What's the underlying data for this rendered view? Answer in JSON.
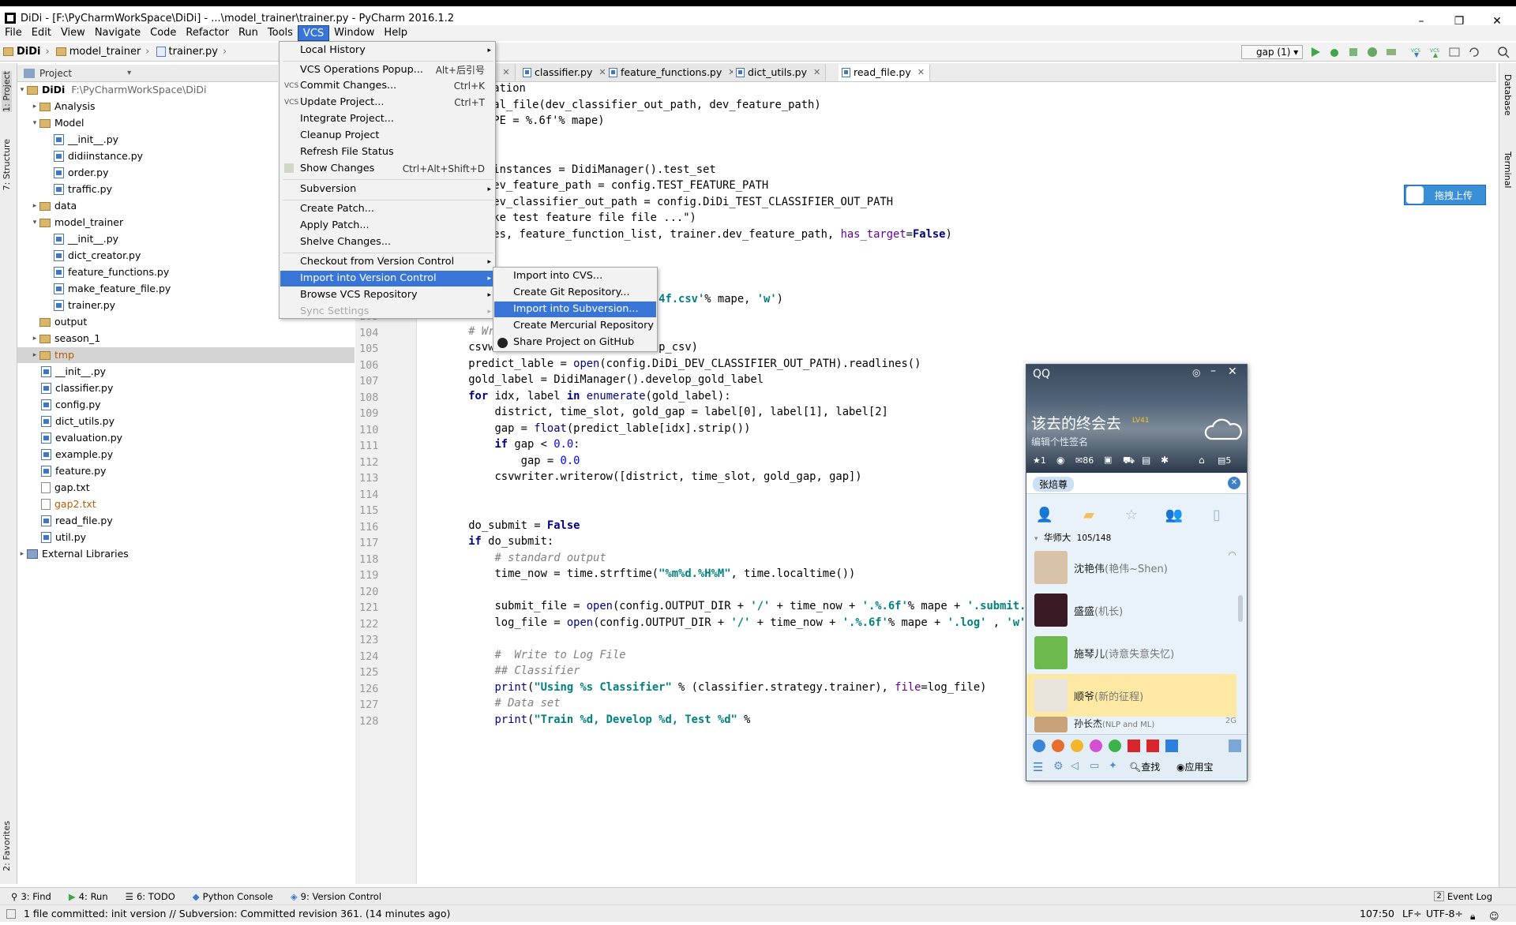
{
  "window": {
    "title": "DiDi - [F:\\PyCharmWorkSpace\\DiDi] - ...\\model_trainer\\trainer.py - PyCharm 2016.1.2"
  },
  "menubar": [
    "File",
    "Edit",
    "View",
    "Navigate",
    "Code",
    "Refactor",
    "Run",
    "Tools",
    "VCS",
    "Window",
    "Help"
  ],
  "breadcrumb": [
    "DiDi",
    "model_trainer",
    "trainer.py"
  ],
  "toolbar": {
    "run_config": "gap (1)"
  },
  "project_panel": {
    "header": "Project",
    "tree": [
      {
        "label": "DiDi",
        "path": "F:\\PyCharmWorkSpace\\DiDi"
      },
      {
        "label": "Analysis"
      },
      {
        "label": "Model"
      },
      {
        "label": "__init__.py"
      },
      {
        "label": "didiinstance.py"
      },
      {
        "label": "order.py"
      },
      {
        "label": "traffic.py"
      },
      {
        "label": "data"
      },
      {
        "label": "model_trainer"
      },
      {
        "label": "__init__.py"
      },
      {
        "label": "dict_creator.py"
      },
      {
        "label": "feature_functions.py"
      },
      {
        "label": "make_feature_file.py"
      },
      {
        "label": "trainer.py"
      },
      {
        "label": "output"
      },
      {
        "label": "season_1"
      },
      {
        "label": "tmp"
      },
      {
        "label": "__init__.py"
      },
      {
        "label": "classifier.py"
      },
      {
        "label": "config.py"
      },
      {
        "label": "dict_utils.py"
      },
      {
        "label": "evaluation.py"
      },
      {
        "label": "example.py"
      },
      {
        "label": "feature.py"
      },
      {
        "label": "gap.txt"
      },
      {
        "label": "gap2.txt"
      },
      {
        "label": "read_file.py"
      },
      {
        "label": "util.py"
      },
      {
        "label": "External Libraries"
      }
    ]
  },
  "editor_tabs": [
    "y",
    "classifier.py",
    "feature_functions.py",
    "dict_utils.py",
    "read_file.py"
  ],
  "vcs_menu": {
    "items": [
      {
        "label": "Local History",
        "shortcut": "",
        "arrow": "▸"
      },
      {
        "label": "VCS Operations Popup...",
        "shortcut": "Alt+后引号"
      },
      {
        "label": "Commit Changes...",
        "shortcut": "Ctrl+K"
      },
      {
        "label": "Update Project...",
        "shortcut": "Ctrl+T"
      },
      {
        "label": "Integrate Project..."
      },
      {
        "label": "Cleanup Project"
      },
      {
        "label": "Refresh File Status"
      },
      {
        "label": "Show Changes",
        "shortcut": "Ctrl+Alt+Shift+D"
      },
      {
        "label": "Subversion",
        "arrow": "▸"
      },
      {
        "label": "Create Patch..."
      },
      {
        "label": "Apply Patch..."
      },
      {
        "label": "Shelve Changes..."
      },
      {
        "label": "Checkout from Version Control",
        "arrow": "▸"
      },
      {
        "label": "Import into Version Control",
        "arrow": "▸"
      },
      {
        "label": "Browse VCS Repository",
        "arrow": "▸"
      },
      {
        "label": "Sync Settings",
        "arrow": "▸"
      }
    ],
    "vcs_icon_label": "VCS"
  },
  "import_submenu": [
    "Import into CVS...",
    "Create Git Repository...",
    "Import into Subversion...",
    "Create Mercurial Repository",
    "Share Project on GitHub"
  ],
  "code_lines": [
    {
      "n": "",
      "t": "uation"
    },
    {
      "n": "",
      "t": "val_file(dev_classifier_out_path, dev_feature_path)"
    },
    {
      "n": "",
      "t": "APE = %.6f'% mape)"
    },
    {
      "n": "",
      "t": ""
    },
    {
      "n": "",
      "t": ""
    },
    {
      "n": "",
      "t": "iinstances = DidiManager().test_set"
    },
    {
      "n": "",
      "t": "dev_feature_path = config.TEST_FEATURE_PATH"
    },
    {
      "n": "",
      "t": "dev_classifier_out_path = config.DiDi_TEST_CLASSIFIER_OUT_PATH"
    },
    {
      "n": "",
      "t": "ake test feature file file ...\")"
    },
    {
      "n": "",
      "t": "ces, feature_function_list, trainer.dev_feature_path, has_target=False)"
    },
    {
      "n": "",
      "t": ""
    },
    {
      "n": "100",
      "t": ""
    },
    {
      "n": "101",
      "t": ""
    },
    {
      "n": "102",
      "t": "    develop_csv = open('develop%.4f.csv'% mape, 'w')"
    },
    {
      "n": "103",
      "t": ""
    },
    {
      "n": "104",
      "t": "    # Write to Develop File"
    },
    {
      "n": "105",
      "t": "    csvwriter = csv.writer(develop_csv)"
    },
    {
      "n": "106",
      "t": "    predict_lable = open(config.DiDi_DEV_CLASSIFIER_OUT_PATH).readlines()"
    },
    {
      "n": "107",
      "t": "    gold_label = DidiManager().develop_gold_label"
    },
    {
      "n": "108",
      "t": "    for idx, label in enumerate(gold_label):"
    },
    {
      "n": "109",
      "t": "        district, time_slot, gold_gap = label[0], label[1], label[2]"
    },
    {
      "n": "110",
      "t": "        gap = float(predict_lable[idx].strip())"
    },
    {
      "n": "111",
      "t": "        if gap < 0.0:"
    },
    {
      "n": "112",
      "t": "            gap = 0.0"
    },
    {
      "n": "113",
      "t": "        csvwriter.writerow([district, time_slot, gold_gap, gap])"
    },
    {
      "n": "114",
      "t": ""
    },
    {
      "n": "115",
      "t": ""
    },
    {
      "n": "116",
      "t": "    do_submit = False"
    },
    {
      "n": "117",
      "t": "    if do_submit:"
    },
    {
      "n": "118",
      "t": "        # standard output"
    },
    {
      "n": "119",
      "t": "        time_now = time.strftime(\"%m%d.%H%M\", time.localtime())"
    },
    {
      "n": "120",
      "t": ""
    },
    {
      "n": "121",
      "t": "        submit_file = open(config.OUTPUT_DIR + '/' + time_now + '.%.6f'% mape + '.submit.csv'"
    },
    {
      "n": "122",
      "t": "        log_file = open(config.OUTPUT_DIR + '/' + time_now + '.%.6f'% mape + '.log' , 'w')"
    },
    {
      "n": "123",
      "t": ""
    },
    {
      "n": "124",
      "t": "        #  Write to Log File"
    },
    {
      "n": "125",
      "t": "        ## Classifier"
    },
    {
      "n": "126",
      "t": "        print(\"Using %s Classifier\" % (classifier.strategy.trainer), file=log_file)"
    },
    {
      "n": "127",
      "t": "        # Data set"
    },
    {
      "n": "128",
      "t": "        print(\"Train %d, Develop %d, Test %d\" %"
    }
  ],
  "qq": {
    "title": "QQ",
    "nickname": "该去的终会去",
    "level_badge": "LV41",
    "signature": "编辑个性签名",
    "stats": {
      "stars": "1",
      "mail": "86",
      "msgs": "5"
    },
    "search_value": "张焙尊",
    "group": {
      "name": "华师大",
      "count": "105/148"
    },
    "friends": [
      {
        "name": "沈艳伟",
        "note": "(艳伟~Shen)"
      },
      {
        "name": "盛盛",
        "note": "(机长)"
      },
      {
        "name": "施琴儿",
        "note": "(诗意失意失忆)"
      },
      {
        "name": "顺爷",
        "note": "(新的征程)"
      },
      {
        "name": "孙长杰",
        "note": "(NLP and ML)"
      }
    ],
    "net_badge": "2G",
    "bottom": {
      "find": "查找",
      "apps": "应用宝"
    }
  },
  "upload_button": "拖拽上传",
  "right_tabs": [
    "Database",
    "Terminal"
  ],
  "left_tabs": [
    "1: Project",
    "7: Structure",
    "2: Favorites"
  ],
  "bottom_tabs": [
    {
      "key": "3",
      "label": "3: Find"
    },
    {
      "key": "4",
      "label": "4: Run"
    },
    {
      "key": "6",
      "label": "6: TODO"
    },
    {
      "key": "py",
      "label": "Python Console"
    },
    {
      "key": "9",
      "label": "9: Version Control"
    }
  ],
  "event_log": "Event Log",
  "event_count": "2",
  "status": {
    "message": "1 file committed: init version // Subversion: Committed revision 361. (14 minutes ago)",
    "position": "107:50",
    "line_sep": "LF÷",
    "encoding": "UTF-8÷"
  }
}
